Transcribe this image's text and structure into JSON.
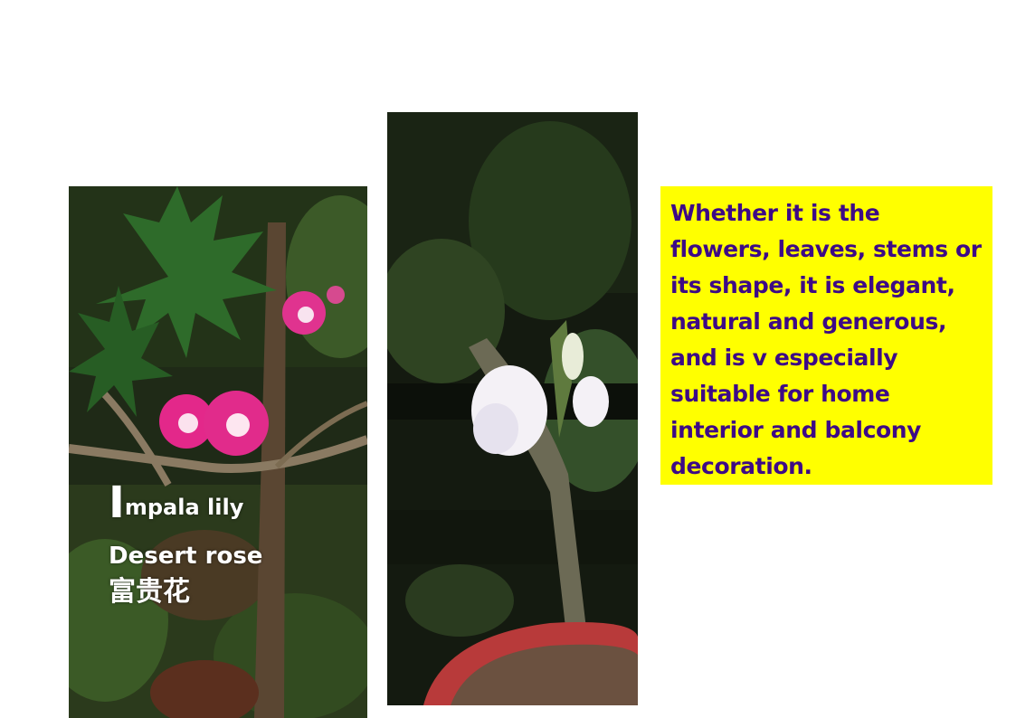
{
  "left_photo": {
    "subject": "pink desert rose flowers under papaya leaves",
    "title_initial": "I",
    "title_rest": "mpala lily",
    "name_en": "Desert rose",
    "name_cn": "富贵花"
  },
  "right_photo": {
    "subject": "white double-petal desert rose in a red pot"
  },
  "description": {
    "text": "Whether it is the flowers, leaves, stems or its shape, it is elegant, natural and generous, and is v especially suitable for home interior and balcony decoration.",
    "background_color": "#ffff00",
    "text_color": "#3d0a86"
  }
}
